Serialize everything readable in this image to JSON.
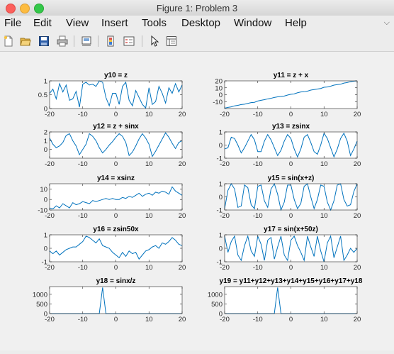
{
  "window": {
    "title": "Figure 1: Problem 3"
  },
  "menubar": {
    "items": [
      "File",
      "Edit",
      "View",
      "Insert",
      "Tools",
      "Desktop",
      "Window",
      "Help"
    ]
  },
  "toolbar": {
    "icons": [
      "new-figure-icon",
      "open-file-icon",
      "save-icon",
      "print-icon",
      "link-plot-icon",
      "insert-colorbar-icon",
      "insert-legend-icon",
      "pointer-icon",
      "property-inspector-icon"
    ]
  },
  "colors": {
    "line": "#0072bd",
    "axes": "#262626",
    "figure_bg": "#f0f0f0",
    "axes_bg": "#ffffff"
  },
  "chart_data": [
    {
      "type": "line",
      "title": "y10 = z",
      "xlim": [
        -20,
        20
      ],
      "ylim": [
        0,
        1
      ],
      "xticks": [
        -20,
        -10,
        0,
        10,
        20
      ],
      "yticks": [
        0,
        0.5,
        1
      ],
      "xticklabels": [
        "-20",
        "-10",
        "0",
        "10",
        "20"
      ],
      "yticklabels": [
        "0",
        "0.5",
        "1"
      ],
      "x": [
        -20,
        -19,
        -18,
        -17,
        -16,
        -15,
        -14,
        -13,
        -12,
        -11,
        -10,
        -9,
        -8,
        -7,
        -6,
        -5,
        -4,
        -3,
        -2,
        -1,
        0,
        1,
        2,
        3,
        4,
        5,
        6,
        7,
        8,
        9,
        10,
        11,
        12,
        13,
        14,
        15,
        16,
        17,
        18,
        19,
        20
      ],
      "y": [
        0.55,
        0.7,
        0.35,
        0.9,
        0.6,
        0.85,
        0.3,
        0.35,
        0.62,
        0.05,
        0.88,
        0.95,
        0.85,
        0.88,
        0.8,
        1.0,
        0.95,
        0.4,
        0.1,
        0.55,
        0.55,
        0.15,
        0.8,
        0.95,
        0.3,
        0.1,
        0.65,
        0.4,
        0.15,
        0.02,
        0.75,
        0.15,
        0.25,
        0.8,
        0.55,
        0.2,
        0.75,
        0.55,
        0.9,
        0.6,
        0.85
      ]
    },
    {
      "type": "line",
      "title": "y11 = z + x",
      "xlim": [
        -20,
        20
      ],
      "ylim": [
        -20,
        20
      ],
      "xticks": [
        -20,
        -10,
        0,
        10,
        20
      ],
      "yticks": [
        -10,
        0,
        10,
        20
      ],
      "xticklabels": [
        "-20",
        "-10",
        "0",
        "10",
        "20"
      ],
      "yticklabels": [
        "-10",
        "0",
        "10",
        "20"
      ],
      "x": [
        -20,
        -19,
        -18,
        -17,
        -16,
        -15,
        -14,
        -13,
        -12,
        -11,
        -10,
        -9,
        -8,
        -7,
        -6,
        -5,
        -4,
        -3,
        -2,
        -1,
        0,
        1,
        2,
        3,
        4,
        5,
        6,
        7,
        8,
        9,
        10,
        11,
        12,
        13,
        14,
        15,
        16,
        17,
        18,
        19,
        20
      ],
      "y": [
        -19.5,
        -18.3,
        -17.6,
        -16.1,
        -15.4,
        -14.2,
        -13.7,
        -12.6,
        -11.4,
        -11.0,
        -9.1,
        -8.1,
        -7.2,
        -6.1,
        -5.2,
        -4.0,
        -3.1,
        -2.6,
        -1.9,
        -0.5,
        0.6,
        1.2,
        2.8,
        4.0,
        4.3,
        5.1,
        6.7,
        7.4,
        8.2,
        9.0,
        10.8,
        11.2,
        12.3,
        13.8,
        14.6,
        15.2,
        16.8,
        17.6,
        18.9,
        19.6,
        20.0
      ]
    },
    {
      "type": "line",
      "title": "y12 = z + sinx",
      "xlim": [
        -20,
        20
      ],
      "ylim": [
        -1,
        2
      ],
      "xticks": [
        -20,
        -10,
        0,
        10,
        20
      ],
      "yticks": [
        0,
        1,
        2
      ],
      "xticklabels": [
        "-20",
        "-10",
        "0",
        "10",
        "20"
      ],
      "yticklabels": [
        "0",
        "1",
        "2"
      ],
      "x": [
        -20,
        -19,
        -18,
        -17,
        -16,
        -15,
        -14,
        -13,
        -12,
        -11,
        -10,
        -9,
        -8,
        -7,
        -6,
        -5,
        -4,
        -3,
        -2,
        -1,
        0,
        1,
        2,
        3,
        4,
        5,
        6,
        7,
        8,
        9,
        10,
        11,
        12,
        13,
        14,
        15,
        16,
        17,
        18,
        19,
        20
      ],
      "y": [
        1.3,
        0.6,
        0.2,
        0.4,
        0.8,
        1.6,
        1.8,
        1.0,
        0.4,
        -0.6,
        0.0,
        0.6,
        1.8,
        1.5,
        1.0,
        0.2,
        -0.4,
        0.0,
        0.5,
        0.9,
        1.4,
        1.8,
        1.5,
        0.8,
        -0.7,
        -0.3,
        0.4,
        1.2,
        1.8,
        1.3,
        0.6,
        -0.8,
        -0.2,
        0.5,
        1.2,
        1.9,
        1.4,
        0.7,
        0.1,
        0.8,
        1.0
      ]
    },
    {
      "type": "line",
      "title": "y13 = zsinx",
      "xlim": [
        -20,
        20
      ],
      "ylim": [
        -1,
        1
      ],
      "xticks": [
        -20,
        -10,
        0,
        10,
        20
      ],
      "yticks": [
        -1,
        0,
        1
      ],
      "xticklabels": [
        "-20",
        "-10",
        "0",
        "10",
        "20"
      ],
      "yticklabels": [
        "-1",
        "0",
        "1"
      ],
      "x": [
        -20,
        -19,
        -18,
        -17,
        -16,
        -15,
        -14,
        -13,
        -12,
        -11,
        -10,
        -9,
        -8,
        -7,
        -6,
        -5,
        -4,
        -3,
        -2,
        -1,
        0,
        1,
        2,
        3,
        4,
        5,
        6,
        7,
        8,
        9,
        10,
        11,
        12,
        13,
        14,
        15,
        16,
        17,
        18,
        19,
        20
      ],
      "y": [
        -0.3,
        -0.2,
        0.6,
        0.5,
        0.0,
        -0.6,
        -0.2,
        0.3,
        0.8,
        0.4,
        -0.5,
        -0.5,
        0.3,
        0.8,
        0.4,
        -0.2,
        -0.8,
        -0.4,
        0.3,
        0.8,
        0.5,
        -0.3,
        -0.9,
        -0.3,
        0.6,
        0.8,
        0.2,
        -0.5,
        -0.7,
        0.0,
        0.9,
        0.5,
        -0.2,
        -0.9,
        -0.3,
        0.5,
        0.9,
        0.3,
        -0.8,
        -0.3,
        0.3
      ]
    },
    {
      "type": "line",
      "title": "y14 = xsinz",
      "xlim": [
        -20,
        20
      ],
      "ylim": [
        -10,
        15
      ],
      "xticks": [
        -20,
        -10,
        0,
        10,
        20
      ],
      "yticks": [
        -10,
        0,
        10
      ],
      "xticklabels": [
        "-20",
        "-10",
        "0",
        "10",
        "20"
      ],
      "yticklabels": [
        "-10",
        "0",
        "10"
      ],
      "x": [
        -20,
        -19,
        -18,
        -17,
        -16,
        -15,
        -14,
        -13,
        -12,
        -11,
        -10,
        -9,
        -8,
        -7,
        -6,
        -5,
        -4,
        -3,
        -2,
        -1,
        0,
        1,
        2,
        3,
        4,
        5,
        6,
        7,
        8,
        9,
        10,
        11,
        12,
        13,
        14,
        15,
        16,
        17,
        18,
        19,
        20
      ],
      "y": [
        -8,
        -9,
        -6,
        -8,
        -4,
        -6,
        -8,
        -3,
        -5,
        -4,
        -2,
        -3,
        -4,
        -1,
        -2,
        -1,
        0,
        1,
        0,
        1,
        0,
        0,
        2,
        1,
        3,
        2,
        4,
        6,
        3,
        5,
        6,
        4,
        7,
        6,
        8,
        7,
        5,
        12,
        8,
        6,
        4
      ]
    },
    {
      "type": "line",
      "title": "y15 = sin(x+z)",
      "xlim": [
        -20,
        20
      ],
      "ylim": [
        -1,
        1
      ],
      "xticks": [
        -20,
        -10,
        0,
        10,
        20
      ],
      "yticks": [
        -1,
        0,
        1
      ],
      "xticklabels": [
        "-20",
        "-10",
        "0",
        "10",
        "20"
      ],
      "yticklabels": [
        "-1",
        "0",
        "1"
      ],
      "x": [
        -20,
        -19,
        -18,
        -17,
        -16,
        -15,
        -14,
        -13,
        -12,
        -11,
        -10,
        -9,
        -8,
        -7,
        -6,
        -5,
        -4,
        -3,
        -2,
        -1,
        0,
        1,
        2,
        3,
        4,
        5,
        6,
        7,
        8,
        9,
        10,
        11,
        12,
        13,
        14,
        15,
        16,
        17,
        18,
        19,
        20
      ],
      "y": [
        -0.9,
        0.5,
        1.0,
        0.6,
        -0.8,
        -0.7,
        0.9,
        0.7,
        -0.6,
        -0.9,
        0.8,
        0.9,
        -0.3,
        -0.8,
        0.6,
        1.0,
        0.2,
        -1.0,
        -0.4,
        0.9,
        0.9,
        -0.2,
        -0.9,
        -0.5,
        0.8,
        1.0,
        0.0,
        -0.9,
        -0.2,
        0.9,
        0.8,
        -0.4,
        -1.0,
        -0.3,
        0.9,
        1.0,
        -0.2,
        -0.7,
        -0.6,
        0.4,
        1.0
      ]
    },
    {
      "type": "line",
      "title": "y16 = zsin50x",
      "xlim": [
        -20,
        20
      ],
      "ylim": [
        -1,
        1
      ],
      "xticks": [
        -20,
        -10,
        0,
        10,
        20
      ],
      "yticks": [
        -1,
        0,
        1
      ],
      "xticklabels": [
        "-20",
        "-10",
        "0",
        "10",
        "20"
      ],
      "yticklabels": [
        "-1",
        "0",
        "1"
      ],
      "x": [
        -20,
        -19,
        -18,
        -17,
        -16,
        -15,
        -14,
        -13,
        -12,
        -11,
        -10,
        -9,
        -8,
        -7,
        -6,
        -5,
        -4,
        -3,
        -2,
        -1,
        0,
        1,
        2,
        3,
        4,
        5,
        6,
        7,
        8,
        9,
        10,
        11,
        12,
        13,
        14,
        15,
        16,
        17,
        18,
        19,
        20
      ],
      "y": [
        -0.2,
        -0.4,
        -0.2,
        -0.5,
        -0.3,
        -0.1,
        0.0,
        0.1,
        0.1,
        0.3,
        0.5,
        0.9,
        0.8,
        0.6,
        0.4,
        0.7,
        0.2,
        0.1,
        0.0,
        -0.3,
        -0.5,
        -0.7,
        -0.3,
        -0.6,
        -0.2,
        -0.4,
        -0.3,
        -0.8,
        -0.5,
        -0.2,
        -0.1,
        0.1,
        0.2,
        0.0,
        0.4,
        0.3,
        0.5,
        0.8,
        0.6,
        0.3,
        0.2
      ]
    },
    {
      "type": "line",
      "title": "y17 = sin(x+50z)",
      "xlim": [
        -20,
        20
      ],
      "ylim": [
        -1,
        1
      ],
      "xticks": [
        -20,
        -10,
        0,
        10,
        20
      ],
      "yticks": [
        -1,
        0,
        1
      ],
      "xticklabels": [
        "-20",
        "-10",
        "0",
        "10",
        "20"
      ],
      "yticklabels": [
        "-1",
        "0",
        "1"
      ],
      "x": [
        -20,
        -19,
        -18,
        -17,
        -16,
        -15,
        -14,
        -13,
        -12,
        -11,
        -10,
        -9,
        -8,
        -7,
        -6,
        -5,
        -4,
        -3,
        -2,
        -1,
        0,
        1,
        2,
        3,
        4,
        5,
        6,
        7,
        8,
        9,
        10,
        11,
        12,
        13,
        14,
        15,
        16,
        17,
        18,
        19,
        20
      ],
      "y": [
        0.9,
        -0.3,
        0.5,
        0.9,
        -0.5,
        -0.9,
        0.2,
        0.9,
        -0.2,
        -0.6,
        0.9,
        0.3,
        -0.9,
        0.6,
        0.8,
        -0.8,
        0.1,
        0.9,
        -0.5,
        -0.9,
        0.6,
        0.9,
        0.2,
        -0.3,
        -0.9,
        0.9,
        0.1,
        -0.6,
        0.9,
        -0.2,
        -1.0,
        0.4,
        0.9,
        -0.7,
        0.1,
        0.9,
        -0.9,
        -0.5,
        0.0,
        -0.3,
        0.0
      ]
    },
    {
      "type": "line",
      "title": "y18 = sinx/z",
      "xlim": [
        -20,
        20
      ],
      "ylim": [
        0,
        1400
      ],
      "xticks": [
        -20,
        -10,
        0,
        10,
        20
      ],
      "yticks": [
        0,
        500,
        1000
      ],
      "xticklabels": [
        "-20",
        "-10",
        "0",
        "10",
        "20"
      ],
      "yticklabels": [
        "0",
        "500",
        "1000"
      ],
      "x": [
        -20,
        -19,
        -18,
        -17,
        -16,
        -15,
        -14,
        -13,
        -12,
        -11,
        -10,
        -9,
        -8,
        -7,
        -6,
        -5,
        -4,
        -3,
        -2,
        -1,
        0,
        1,
        2,
        3,
        4,
        5,
        6,
        7,
        8,
        9,
        10,
        11,
        12,
        13,
        14,
        15,
        16,
        17,
        18,
        19,
        20
      ],
      "y": [
        0,
        0,
        0,
        0,
        0,
        0,
        0,
        0,
        0,
        0,
        0,
        0,
        0,
        0,
        0,
        0,
        1350,
        0,
        0,
        0,
        0,
        0,
        0,
        0,
        0,
        0,
        0,
        0,
        0,
        0,
        0,
        0,
        0,
        0,
        0,
        0,
        0,
        0,
        0,
        0,
        0
      ]
    },
    {
      "type": "line",
      "title": "y19 = y11+y12+y13+y14+y15+y16+y17+y18",
      "xlim": [
        -20,
        20
      ],
      "ylim": [
        0,
        1400
      ],
      "xticks": [
        -20,
        -10,
        0,
        10,
        20
      ],
      "yticks": [
        0,
        500,
        1000
      ],
      "xticklabels": [
        "-20",
        "-10",
        "0",
        "10",
        "20"
      ],
      "yticklabels": [
        "0",
        "500",
        "1000"
      ],
      "x": [
        -20,
        -19,
        -18,
        -17,
        -16,
        -15,
        -14,
        -13,
        -12,
        -11,
        -10,
        -9,
        -8,
        -7,
        -6,
        -5,
        -4,
        -3,
        -2,
        -1,
        0,
        1,
        2,
        3,
        4,
        5,
        6,
        7,
        8,
        9,
        10,
        11,
        12,
        13,
        14,
        15,
        16,
        17,
        18,
        19,
        20
      ],
      "y": [
        0,
        0,
        0,
        0,
        0,
        0,
        0,
        0,
        0,
        0,
        0,
        0,
        0,
        0,
        0,
        0,
        1350,
        0,
        0,
        0,
        0,
        0,
        0,
        0,
        0,
        0,
        0,
        0,
        0,
        0,
        0,
        0,
        0,
        0,
        0,
        0,
        0,
        0,
        0,
        0,
        0
      ]
    }
  ]
}
